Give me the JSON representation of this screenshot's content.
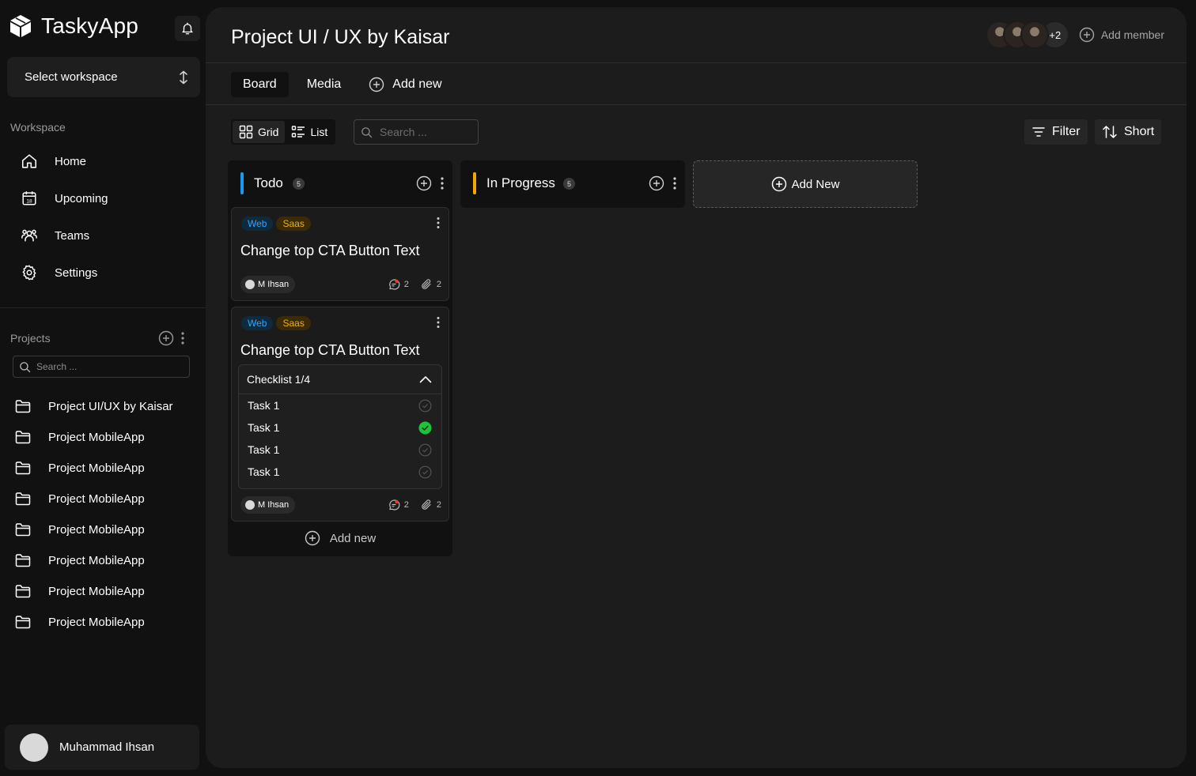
{
  "app": {
    "name": "TaskyApp"
  },
  "sidebar": {
    "workspace_select": "Select workspace",
    "workspace_label": "Workspace",
    "nav": [
      {
        "label": "Home",
        "icon": "home-icon"
      },
      {
        "label": "Upcoming",
        "icon": "calendar-icon"
      },
      {
        "label": "Teams",
        "icon": "team-icon"
      },
      {
        "label": "Settings",
        "icon": "gear-icon"
      }
    ],
    "projects_label": "Projects",
    "projects_search_placeholder": "Search ...",
    "projects": [
      "Project UI/UX by Kaisar",
      "Project MobileApp",
      "Project MobileApp",
      "Project MobileApp",
      "Project MobileApp",
      "Project MobileApp",
      "Project MobileApp",
      "Project MobileApp"
    ],
    "user": {
      "name": "Muhammad Ihsan"
    }
  },
  "header": {
    "title": "Project UI / UX by Kaisar",
    "extra_members": "+2",
    "add_member": "Add member"
  },
  "tabs": {
    "board": "Board",
    "media": "Media",
    "add_new": "Add new"
  },
  "toolbar": {
    "grid": "Grid",
    "list": "List",
    "search_placeholder": "Search ...",
    "filter": "Filter",
    "sort": "Short"
  },
  "columns": {
    "todo": {
      "title": "Todo",
      "count": "5",
      "accent": "#1a9bf0",
      "cards": [
        {
          "tags": [
            "Web",
            "Saas"
          ],
          "title": "Change top CTA Button Text",
          "assignee": "M Ihsan",
          "comments": "2",
          "attachments": "2"
        },
        {
          "tags": [
            "Web",
            "Saas"
          ],
          "title": "Change top CTA Button Text",
          "checklist": {
            "title": "Checklist 1/4",
            "items": [
              {
                "label": "Task 1",
                "done": false
              },
              {
                "label": "Task 1",
                "done": true
              },
              {
                "label": "Task 1",
                "done": false
              },
              {
                "label": "Task 1",
                "done": false
              }
            ]
          },
          "assignee": "M Ihsan",
          "comments": "2",
          "attachments": "2"
        }
      ],
      "add_new": "Add new"
    },
    "in_progress": {
      "title": "In Progress",
      "count": "5",
      "accent": "#f5a800"
    }
  },
  "add_column": "Add New",
  "colors": {
    "check_done": "#1fc33a",
    "tag_web": "#2fa6ff",
    "tag_saas": "#f0b400"
  }
}
